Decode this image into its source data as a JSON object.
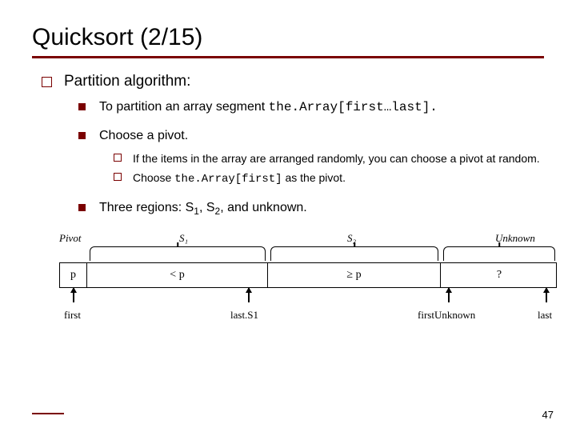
{
  "title": "Quicksort (2/15)",
  "bullets": {
    "lvl1": "Partition algorithm:",
    "lvl2": {
      "a_pre": "To partition an array segment ",
      "a_code": "the.Array[first…last].",
      "b": "Choose a pivot.",
      "c_pre": "Three regions: S",
      "c_s1": "1",
      "c_mid": ", S",
      "c_s2": "2",
      "c_post": ", and unknown."
    },
    "lvl3": {
      "a": "If the items in the array are arranged randomly, you can choose a pivot at random.",
      "b_pre": "Choose ",
      "b_code": "the.Array[first]",
      "b_post": " as the pivot."
    }
  },
  "diagram": {
    "top": {
      "pivot": "Pivot",
      "s1": "S₁",
      "s2": "S₂",
      "unknown": "Unknown"
    },
    "seg": {
      "pivot": "p",
      "lt": "< p",
      "ge": "≥ p",
      "unk": "?"
    },
    "bot": {
      "first": "first",
      "lastS1": "last.S1",
      "firstUnknown": "firstUnknown",
      "last": "last"
    }
  },
  "page": "47"
}
